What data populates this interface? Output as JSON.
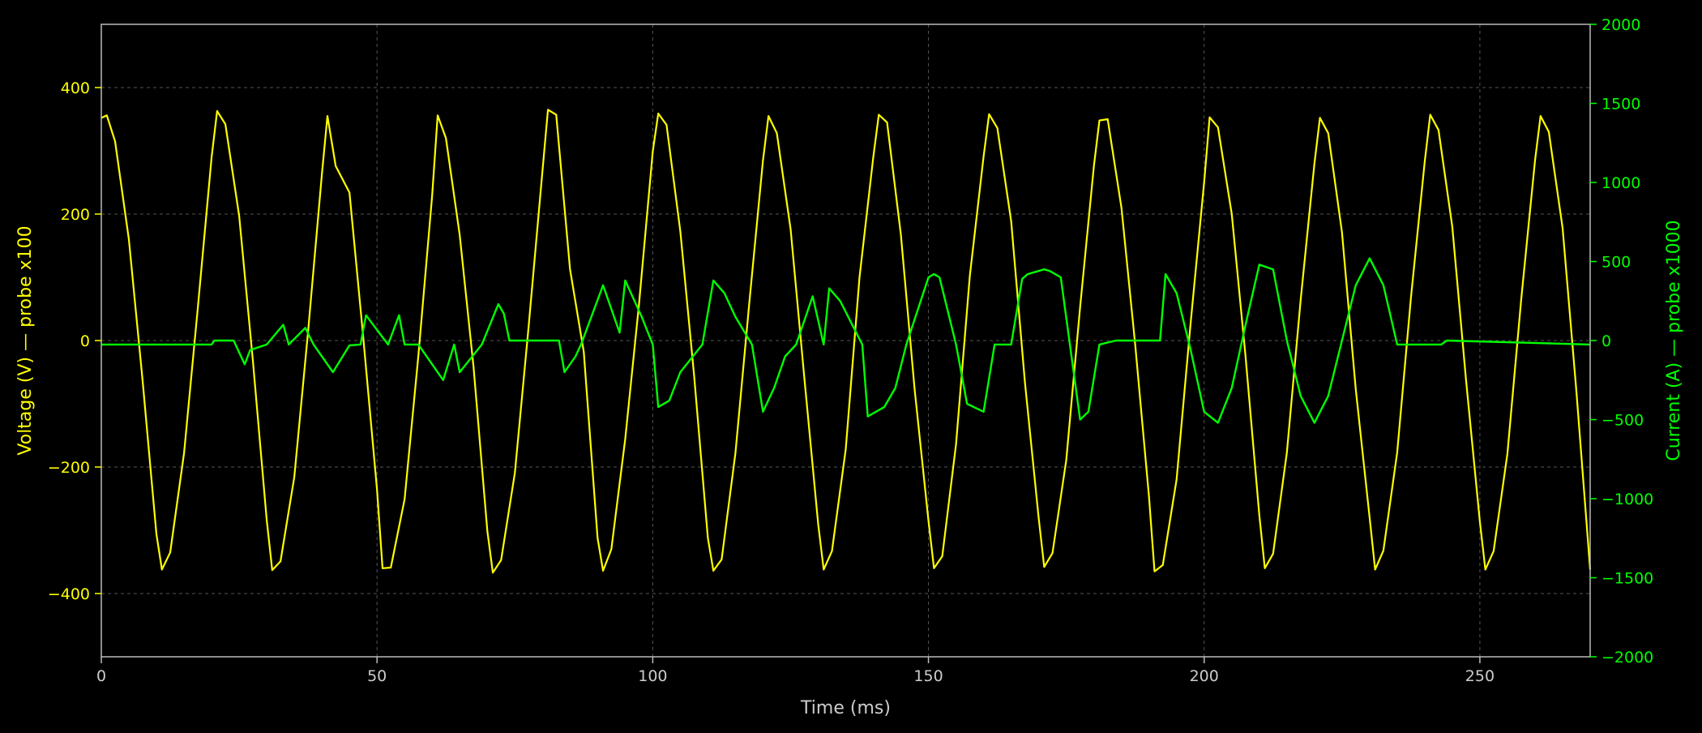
{
  "chart_data": {
    "type": "line",
    "xlabel": "Time (ms)",
    "ylabel_left": "Voltage (V)  —  probe x100",
    "ylabel_right": "Current (A)  —  probe x1000",
    "xlim": [
      0,
      270
    ],
    "ylim_left": [
      -500,
      500
    ],
    "ylim_right": [
      -2000,
      2000
    ],
    "x_ticks": [
      0,
      50,
      100,
      150,
      200,
      250
    ],
    "x_tick_labels": [
      "0",
      "50",
      "100",
      "150",
      "200",
      "250"
    ],
    "y_left_ticks": [
      -400,
      -200,
      0,
      200,
      400
    ],
    "y_left_tick_labels": [
      "−400",
      "−200",
      "0",
      "200",
      "400"
    ],
    "y_right_ticks": [
      -2000,
      -1500,
      -1000,
      -500,
      0,
      500,
      1000,
      1500,
      2000
    ],
    "y_right_tick_labels": [
      "−2000",
      "−1500",
      "−1000",
      "−500",
      "0",
      "500",
      "1000",
      "1500",
      "2000"
    ],
    "grid": true,
    "colors": {
      "background": "#000000",
      "frame": "#bbbbbb",
      "grid": "#555555",
      "voltage": "#ffff00",
      "current": "#00ff00",
      "x_axis_text": "#cccccc"
    },
    "series": [
      {
        "axis": "left",
        "color": "#ffff00",
        "description": "voltage waveform, sinusoid ~360 V peak with switching spikes",
        "x": [
          0,
          1.0,
          2.5,
          5.0,
          7.5,
          10.0,
          11.0,
          12.5,
          15.0,
          17.5,
          20.0,
          21.0,
          22.5,
          25.0,
          27.5,
          30.0,
          31.0,
          32.5,
          35.0,
          37.5,
          40.0,
          41.0,
          42.5,
          45.0,
          47.5,
          50.0,
          51.0,
          52.5,
          55.0,
          57.5,
          60.0,
          61.0,
          62.5,
          65.0,
          67.5,
          70.0,
          71.0,
          72.5,
          75.0,
          77.5,
          80.0,
          81.0,
          82.5,
          85.0,
          87.5,
          90.0,
          91.0,
          92.5,
          95.0,
          97.5,
          100.0,
          101.0,
          102.5,
          105.0,
          107.5,
          110.0,
          111.0,
          112.5,
          115.0,
          117.5,
          120.0,
          121.0,
          122.5,
          125.0,
          127.5,
          130.0,
          131.0,
          132.5,
          135.0,
          137.5,
          140.0,
          141.0,
          142.5,
          145.0,
          147.5,
          150.0,
          151.0,
          152.5,
          155.0,
          157.5,
          160.0,
          161.0,
          162.5,
          165.0,
          167.5,
          170.0,
          171.0,
          172.5,
          175.0,
          177.5,
          180.0,
          181.0,
          182.5,
          185.0,
          187.5,
          190.0,
          191.0,
          192.5,
          195.0,
          197.5,
          200.0,
          201.0,
          202.5,
          205.0,
          207.5,
          210.0,
          211.0,
          212.5,
          215.0,
          217.5,
          220.0,
          221.0,
          222.5,
          225.0,
          227.5,
          230.0,
          231.0,
          232.5,
          235.0,
          237.5,
          240.0,
          241.0,
          242.5,
          245.0,
          247.5,
          250.0,
          251.0,
          252.5,
          255.0,
          257.5,
          260.0,
          261.0,
          262.5,
          265.0,
          267.5,
          270.0
        ],
        "y": [
          352,
          356,
          315,
          160,
          -64,
          -306,
          -362,
          -335,
          -178,
          52,
          290,
          363,
          342,
          197,
          -33,
          -284,
          -363,
          -349,
          -216,
          14,
          262,
          355,
          276,
          234,
          5,
          -236,
          -360,
          -359,
          -251,
          -24,
          229,
          356,
          320,
          167,
          -42,
          -301,
          -367,
          -347,
          -209,
          23,
          268,
          365,
          357,
          113,
          -18,
          -312,
          -364,
          -330,
          -156,
          57,
          299,
          359,
          341,
          173,
          -55,
          -312,
          -364,
          -346,
          -178,
          58,
          285,
          355,
          328,
          176,
          -60,
          -290,
          -362,
          -333,
          -172,
          100,
          290,
          357,
          345,
          168,
          -77,
          -285,
          -360,
          -341,
          -164,
          102,
          291,
          358,
          336,
          189,
          -66,
          -281,
          -358,
          -336,
          -189,
          53,
          276,
          348,
          350,
          210,
          -7,
          -247,
          -365,
          -355,
          -220,
          23,
          250,
          353,
          337,
          200,
          -25,
          -276,
          -360,
          -337,
          -177,
          64,
          280,
          352,
          328,
          171,
          -77,
          -280,
          -362,
          -332,
          -177,
          68,
          283,
          357,
          333,
          180,
          -63,
          -286,
          -362,
          -333,
          -179,
          66,
          285,
          355,
          330,
          178,
          -80,
          -362
        ]
      },
      {
        "axis": "right",
        "color": "#00ff00",
        "description": "current waveform, conduction pulses at switching events",
        "x": [
          0,
          20.0,
          20.5,
          24.0,
          26.0,
          27.0,
          30.0,
          33.0,
          34.0,
          37.0,
          38.5,
          42.0,
          45.0,
          47.0,
          48.0,
          52.0,
          54.0,
          55.0,
          57.5,
          62.0,
          64.0,
          65.0,
          69.0,
          72.0,
          73.0,
          74.0,
          76.0,
          83.0,
          84.0,
          86.0,
          87.0,
          91.0,
          94.0,
          95.0,
          98.0,
          100.0,
          101.0,
          103.0,
          105.0,
          109.0,
          111.0,
          113.0,
          115.0,
          118.0,
          120.0,
          122.0,
          124.0,
          126.0,
          129.0,
          131.0,
          132.0,
          134.0,
          138.0,
          139.0,
          142.0,
          144.0,
          146.0,
          150.0,
          151.0,
          152.0,
          155.0,
          157.0,
          160.0,
          162.0,
          165.0,
          167.0,
          168.0,
          171.0,
          172.0,
          174.0,
          177.5,
          179.0,
          181.0,
          184.0,
          192.0,
          193.0,
          195.0,
          197.5,
          200.0,
          202.5,
          205.0,
          207.5,
          210.0,
          212.5,
          215.0,
          217.5,
          220.0,
          222.5,
          225.0,
          227.5,
          230.0,
          232.5,
          235.0,
          236.0,
          243.0,
          244.0,
          270.0
        ],
        "y": [
          -25,
          -25,
          0,
          0,
          -150,
          -60,
          -25,
          100,
          -25,
          80,
          -25,
          -200,
          -30,
          -25,
          160,
          -25,
          160,
          -25,
          -25,
          -250,
          -25,
          -200,
          -25,
          230,
          170,
          0,
          0,
          0,
          -200,
          -100,
          -25,
          350,
          50,
          380,
          150,
          -25,
          -420,
          -380,
          -200,
          -25,
          380,
          300,
          150,
          -25,
          -450,
          -300,
          -100,
          -25,
          280,
          -25,
          330,
          250,
          -25,
          -480,
          -420,
          -300,
          -25,
          400,
          420,
          400,
          -25,
          -400,
          -450,
          -25,
          -25,
          390,
          420,
          450,
          440,
          400,
          -500,
          -450,
          -25,
          0,
          0,
          420,
          300,
          -50,
          -450,
          -520,
          -300,
          100,
          480,
          450,
          0,
          -350,
          -520,
          -350,
          0,
          350,
          520,
          350,
          -25,
          -25,
          -25,
          0,
          -25
        ]
      }
    ]
  }
}
